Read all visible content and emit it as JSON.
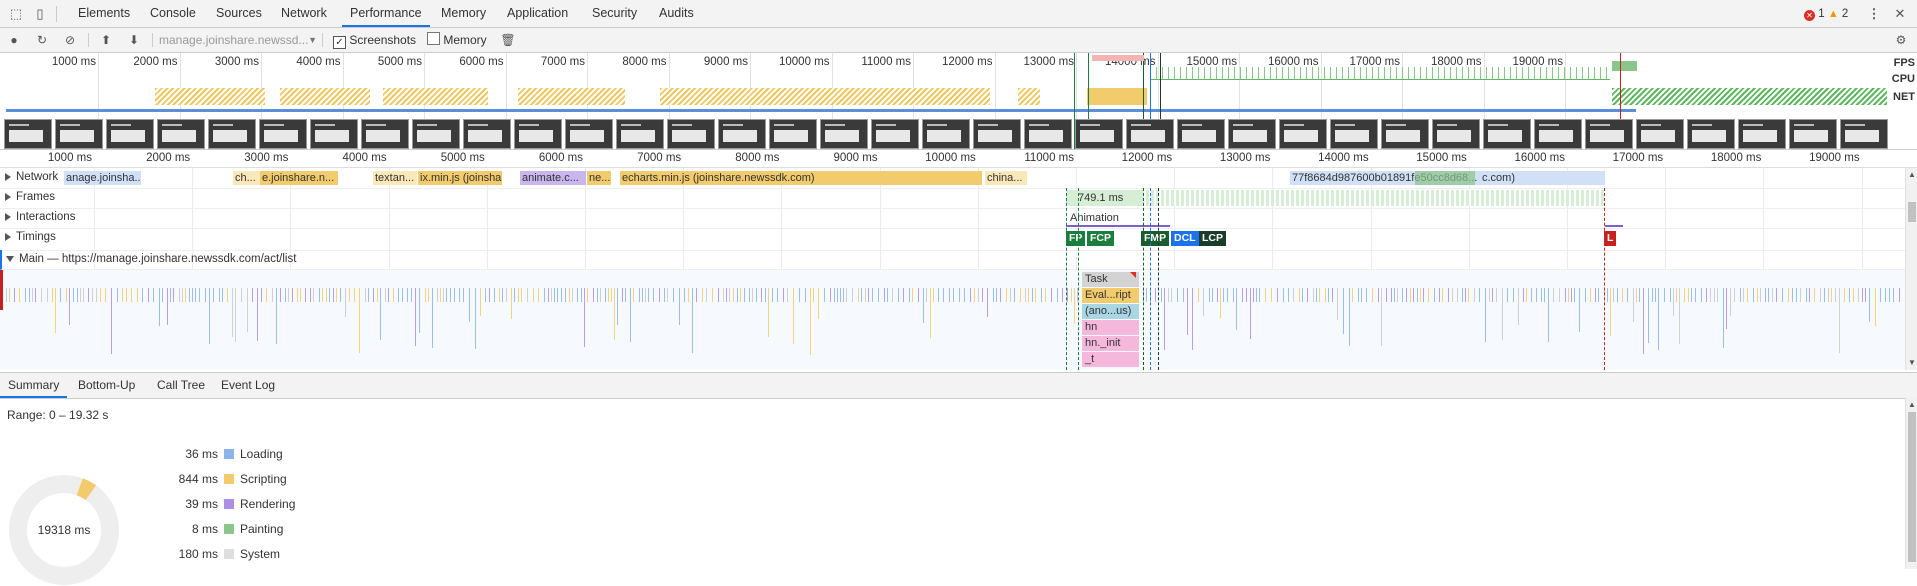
{
  "tabs": {
    "items": [
      {
        "label": "Elements"
      },
      {
        "label": "Console"
      },
      {
        "label": "Sources"
      },
      {
        "label": "Network"
      },
      {
        "label": "Performance"
      },
      {
        "label": "Memory"
      },
      {
        "label": "Application"
      },
      {
        "label": "Security"
      },
      {
        "label": "Audits"
      }
    ],
    "active": "Performance",
    "errors": "1",
    "warnings": "2"
  },
  "toolbar": {
    "profile_select": "manage.joinshare.newssd...",
    "screenshots_label": "Screenshots",
    "screenshots_checked": true,
    "memory_label": "Memory",
    "memory_checked": false
  },
  "overview": {
    "ticks": [
      "1000 ms",
      "2000 ms",
      "3000 ms",
      "4000 ms",
      "5000 ms",
      "6000 ms",
      "7000 ms",
      "8000 ms",
      "9000 ms",
      "10000 ms",
      "11000 ms",
      "12000 ms",
      "13000 ms",
      "14000 ms",
      "15000 ms",
      "16000 ms",
      "17000 ms",
      "18000 ms",
      "19000 ms"
    ],
    "fps_label": "FPS",
    "cpu_label": "CPU",
    "net_label": "NET"
  },
  "ruler": {
    "ticks": [
      "1000 ms",
      "2000 ms",
      "3000 ms",
      "4000 ms",
      "5000 ms",
      "6000 ms",
      "7000 ms",
      "8000 ms",
      "9000 ms",
      "10000 ms",
      "11000 ms",
      "12000 ms",
      "13000 ms",
      "14000 ms",
      "15000 ms",
      "16000 ms",
      "17000 ms",
      "18000 ms",
      "19000 ms"
    ]
  },
  "tracks": {
    "network": {
      "label": "Network",
      "items": [
        {
          "text": "anage.joinsha..."
        },
        {
          "text": "ch..."
        },
        {
          "text": "e.joinshare.n..."
        },
        {
          "text": "textan..."
        },
        {
          "text": "ix.min.js (joinsha"
        },
        {
          "text": "animate.c..."
        },
        {
          "text": "ne..."
        },
        {
          "text": "echarts.min.js (joinshare.newssdk.com)"
        },
        {
          "text": "china..."
        },
        {
          "text": "77f8684d987600b01891fe50cc8d68..."
        },
        {
          "text": "c.com)"
        }
      ]
    },
    "frames": {
      "label": "Frames",
      "frame_time": "749.1 ms"
    },
    "interactions": {
      "label": "Interactions",
      "animation": "Animation"
    },
    "timings": {
      "label": "Timings",
      "markers": [
        {
          "text": "FP",
          "color": "#1a7f3c"
        },
        {
          "text": "FCP",
          "color": "#1a7f3c"
        },
        {
          "text": "FMP",
          "color": "#1a5c2e"
        },
        {
          "text": "DCL",
          "color": "#1a73e8"
        },
        {
          "text": "LCP",
          "color": "#1a3d2a"
        },
        {
          "text": "L",
          "color": "#c5221f"
        }
      ]
    },
    "main": {
      "label": "Main — https://manage.joinshare.newssdk.com/act/list",
      "flame": [
        {
          "text": "Task"
        },
        {
          "text": "Eval...ript"
        },
        {
          "text": "(ano...us)"
        },
        {
          "text": "hn"
        },
        {
          "text": "hn._init"
        },
        {
          "text": "_t"
        }
      ]
    }
  },
  "bottom_tabs": {
    "items": [
      {
        "label": "Summary"
      },
      {
        "label": "Bottom-Up"
      },
      {
        "label": "Call Tree"
      },
      {
        "label": "Event Log"
      }
    ],
    "active": "Summary"
  },
  "summary": {
    "range": "Range: 0 – 19.32 s",
    "total": "19318 ms",
    "rows": [
      {
        "value": "36 ms",
        "label": "Loading",
        "color": "#8cb4e8"
      },
      {
        "value": "844 ms",
        "label": "Scripting",
        "color": "#f2cb6c"
      },
      {
        "value": "39 ms",
        "label": "Rendering",
        "color": "#ad8ee6"
      },
      {
        "value": "8 ms",
        "label": "Painting",
        "color": "#8ac58a"
      },
      {
        "value": "180 ms",
        "label": "System",
        "color": "#dedede"
      }
    ]
  },
  "colors": {
    "accent": "#1a73e8",
    "scripting": "#f2cb6c",
    "loading": "#8cb4e8",
    "rendering": "#ad8ee6",
    "painting": "#8ac58a"
  }
}
